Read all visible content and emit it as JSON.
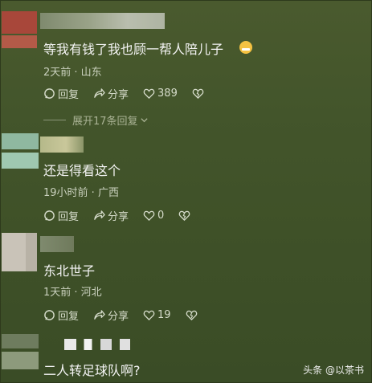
{
  "comments": [
    {
      "text": "等我有钱了我也顾一帮人陪儿子",
      "meta": "2天前 · 山东",
      "reply_label": "回复",
      "share_label": "分享",
      "like_count": "389"
    },
    {
      "text": "还是得看这个",
      "meta": "19小时前 · 广西",
      "reply_label": "回复",
      "share_label": "分享",
      "like_count": "0"
    },
    {
      "text": "东北世子",
      "meta": "1天前 · 河北",
      "reply_label": "回复",
      "share_label": "分享",
      "like_count": "19"
    },
    {
      "text": "二人转足球队啊?"
    }
  ],
  "expand_replies": "展开17条回复",
  "watermark": "头条 @以茶书",
  "emoji_name": "grinning-face-emoji",
  "colors": {
    "background": "#43552b",
    "avatar1": "#a8473a",
    "avatar2": "#8fb8a0",
    "avatar3": "#c9c3b8"
  }
}
